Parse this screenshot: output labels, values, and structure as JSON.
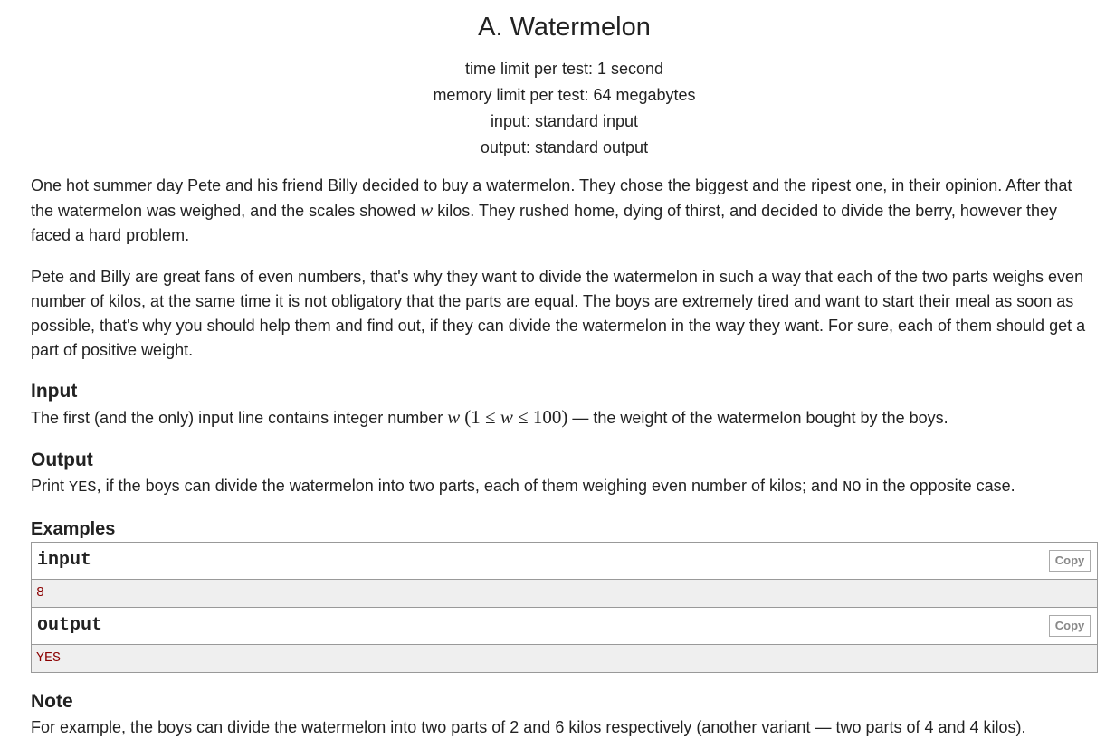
{
  "problem": {
    "title": "A. Watermelon",
    "limits": {
      "time": "time limit per test: 1 second",
      "memory": "memory limit per test: 64 megabytes",
      "input": "input: standard input",
      "output": "output: standard output"
    },
    "statement": {
      "p1_a": "One hot summer day Pete and his friend Billy decided to buy a watermelon. They chose the biggest and the ripest one, in their opinion. After that the watermelon was weighed, and the scales showed ",
      "p1_var": "w",
      "p1_b": " kilos. They rushed home, dying of thirst, and decided to divide the berry, however they faced a hard problem.",
      "p2": "Pete and Billy are great fans of even numbers, that's why they want to divide the watermelon in such a way that each of the two parts weighs even number of kilos, at the same time it is not obligatory that the parts are equal. The boys are extremely tired and want to start their meal as soon as possible, that's why you should help them and find out, if they can divide the watermelon in the way they want. For sure, each of them should get a part of positive weight."
    },
    "input_section": {
      "heading": "Input",
      "text_a": "The first (and the only) input line contains integer number ",
      "var": "w",
      "bounds_open": "(1 ≤ ",
      "bounds_var": "w",
      "bounds_close": " ≤ 100)",
      "text_b": " — the weight of the watermelon bought by the boys."
    },
    "output_section": {
      "heading": "Output",
      "text_a": "Print ",
      "yes": "YES",
      "text_b": ", if the boys can divide the watermelon into two parts, each of them weighing even number of kilos; and ",
      "no": "NO",
      "text_c": " in the opposite case."
    },
    "examples": {
      "heading": "Examples",
      "input_label": "input",
      "input_value": "8",
      "output_label": "output",
      "output_value": "YES",
      "copy_label": "Copy"
    },
    "note": {
      "heading": "Note",
      "text": "For example, the boys can divide the watermelon into two parts of 2 and 6 kilos respectively (another variant — two parts of 4 and 4 kilos)."
    }
  }
}
